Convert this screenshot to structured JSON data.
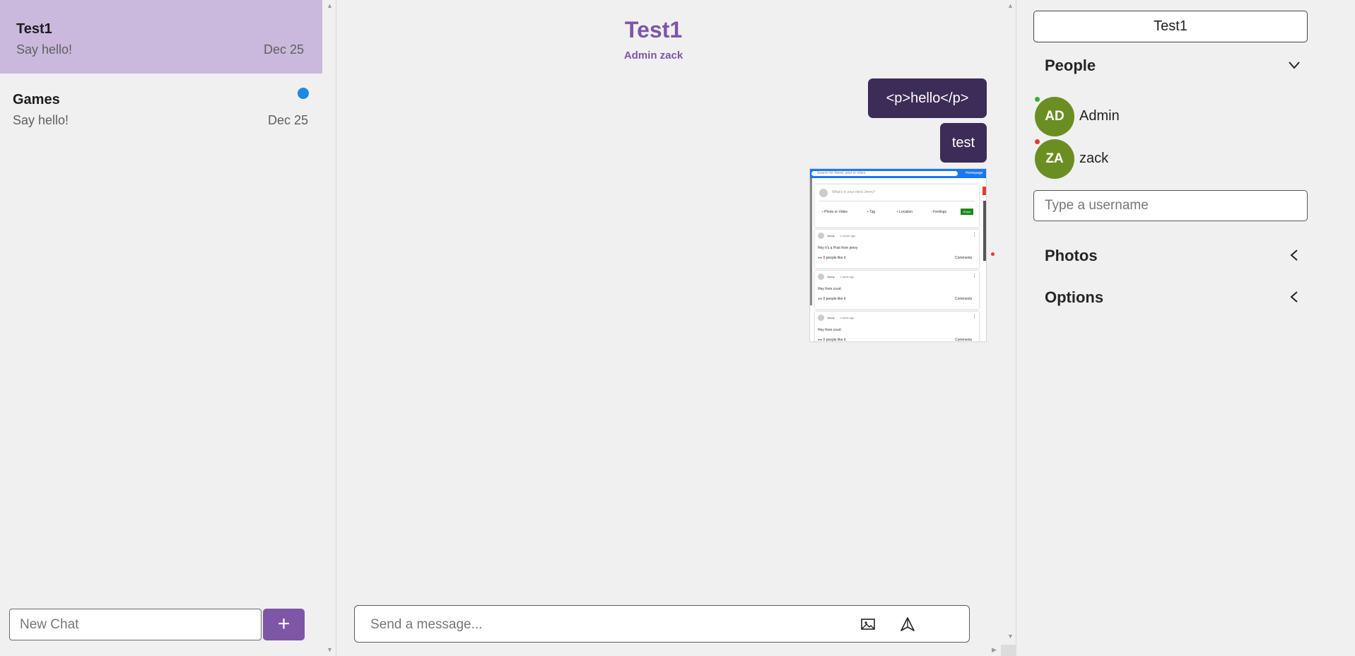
{
  "chat_list": {
    "chats": [
      {
        "title": "Test1",
        "preview": "Say hello!",
        "date": "Dec 25"
      },
      {
        "title": "Games",
        "preview": "Say hello!",
        "date": "Dec 25"
      }
    ],
    "new_chat_placeholder": "New Chat",
    "add_button_label": "+"
  },
  "conversation": {
    "title": "Test1",
    "members": "Admin zack",
    "messages": [
      {
        "text": "<p>hello</p>"
      },
      {
        "text": "test"
      }
    ],
    "composer_placeholder": "Send a message..."
  },
  "details": {
    "chat_name": "Test1",
    "people_label": "People",
    "people": [
      {
        "initials": "AD",
        "name": "Admin"
      },
      {
        "initials": "ZA",
        "name": "zack"
      }
    ],
    "username_placeholder": "Type a username",
    "photos_label": "Photos",
    "options_label": "Options"
  },
  "image_preview": {
    "search_placeholder": "Search for friend, post or video",
    "nav_homepage": "Homepage",
    "share_prompt": "What's in your mind Jenny?",
    "share_options": [
      "Photo or Video",
      "Tag",
      "Location",
      "Feelings"
    ],
    "share_button": "Share",
    "posts": [
      {
        "user": "Jonny",
        "time": "1 month ago",
        "text": "Hey it's a Post from jenny",
        "likes": "0 people like it",
        "comments": "Comments"
      },
      {
        "user": "Jonny",
        "time": "1 week ago",
        "text": "Hey from court",
        "likes": "0 people like it",
        "comments": "Comments"
      },
      {
        "user": "Jonny",
        "time": "1 week ago",
        "text": "Hey from court",
        "likes": "0 people like it",
        "comments": "Comments"
      }
    ]
  },
  "colors": {
    "accent": "#7d55a7",
    "active_chat": "#cab9dc",
    "bubble": "#3b2d57",
    "avatar": "#6b8e23",
    "online": "#2fb22f",
    "offline": "#e53935",
    "unread": "#1e88e5"
  },
  "icons": {
    "image": "image-icon",
    "send": "send-icon",
    "people_chevron": "chevron-down-icon",
    "photos_chevron": "chevron-left-icon",
    "options_chevron": "chevron-left-icon"
  }
}
